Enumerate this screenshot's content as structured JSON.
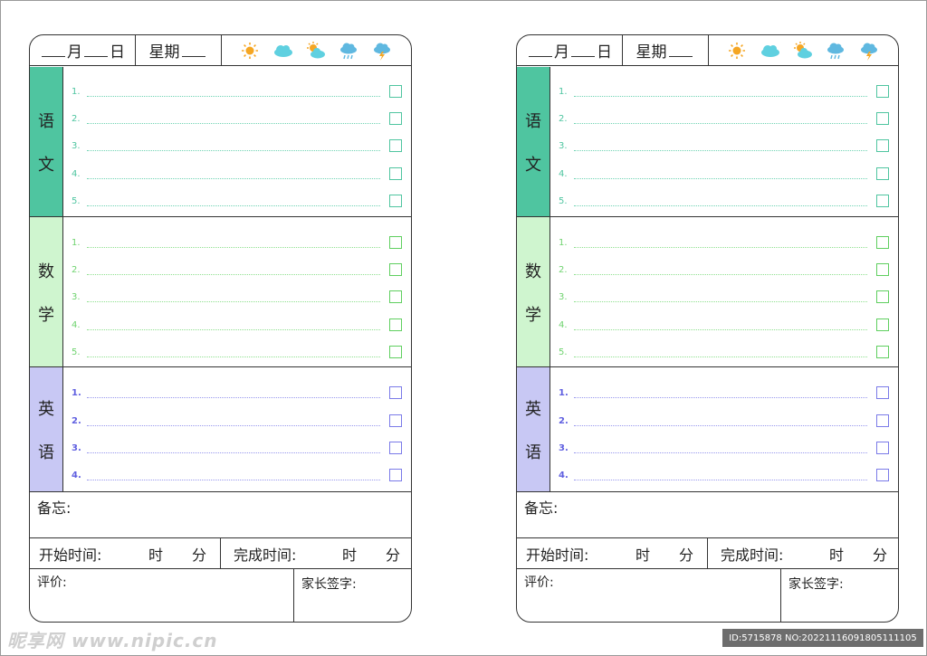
{
  "header": {
    "month": "月",
    "day": "日",
    "weekday": "星期",
    "weather_icons": [
      "sun-icon",
      "cloud-icon",
      "sun-cloud-icon",
      "rain-icon",
      "thunderstorm-icon"
    ]
  },
  "colors": {
    "chinese": "#4fc5a0",
    "math": "#cff5cf",
    "english": "#c8c8f4"
  },
  "subjects": {
    "chinese": {
      "chars": [
        "语",
        "文"
      ],
      "numbers": [
        "1.",
        "2.",
        "3.",
        "4.",
        "5."
      ]
    },
    "math": {
      "chars": [
        "数",
        "学"
      ],
      "numbers": [
        "1.",
        "2.",
        "3.",
        "4.",
        "5."
      ]
    },
    "english": {
      "chars": [
        "英",
        "语"
      ],
      "numbers": [
        "1.",
        "2.",
        "3.",
        "4."
      ]
    }
  },
  "memo": {
    "label": "备忘:"
  },
  "times": {
    "start_label": "开始时间:",
    "end_label": "完成时间:",
    "hour": "时",
    "minute": "分"
  },
  "bottom": {
    "evaluation": "评价:",
    "signature": "家长签字:"
  },
  "watermark": {
    "site": "昵享网 www.nipic.cn",
    "id_text": "ID:5715878 NO:20221116091805111105"
  }
}
